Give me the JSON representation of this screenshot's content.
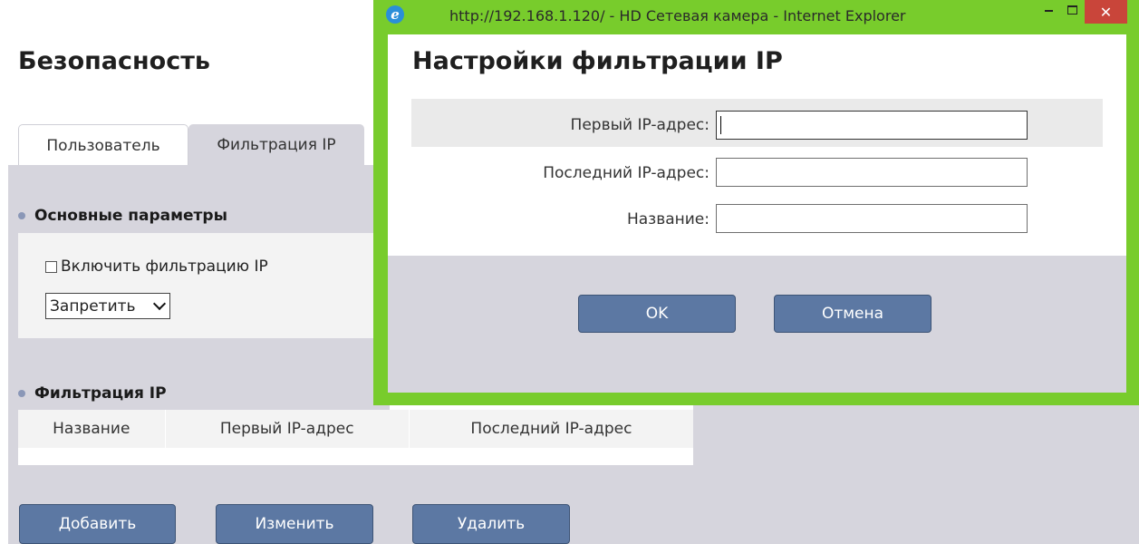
{
  "page": {
    "title": "Безопасность",
    "tabs": [
      {
        "label": "Пользователь",
        "active": false
      },
      {
        "label": "Фильтрация IP",
        "active": true
      }
    ],
    "basic_section": {
      "heading": "Основные параметры",
      "enable_checkbox_label": "Включить фильтрацию IP",
      "enable_checked": false,
      "mode_select_value": "Запретить"
    },
    "filter_section": {
      "heading": "Фильтрация IP",
      "columns": [
        "Название",
        "Первый IP-адрес",
        "Последний IP-адрес"
      ],
      "rows": []
    },
    "buttons": {
      "add": "Добавить",
      "edit": "Изменить",
      "delete": "Удалить"
    }
  },
  "popup": {
    "window_title": "http://192.168.1.120/ - HD Сетевая камера - Internet Explorer",
    "controls": {
      "minimize": "–",
      "maximize": "□",
      "close": "✕"
    },
    "dialog_title": "Настройки фильтрации IP",
    "fields": [
      {
        "label": "Первый IP-адрес:",
        "value": ""
      },
      {
        "label": "Последний IP-адрес:",
        "value": ""
      },
      {
        "label": "Название:",
        "value": ""
      }
    ],
    "ok_label": "OK",
    "cancel_label": "Отмена"
  },
  "colors": {
    "button": "#5c78a3",
    "panel_gray": "#d6d5dd",
    "window_frame": "#78cc2c",
    "close_button": "#c9453a"
  }
}
